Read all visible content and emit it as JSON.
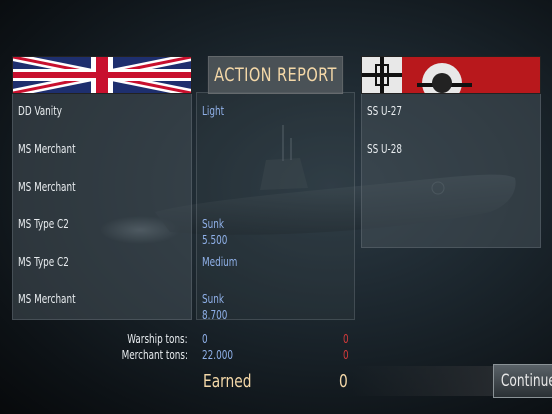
{
  "title": "ACTION REPORT",
  "ally_ships": [
    "DD Vanity",
    "MS Merchant",
    "MS Merchant",
    "MS Type C2",
    "MS Type C2",
    "MS Merchant"
  ],
  "outcomes": [
    {
      "line1": "Light",
      "line2": ""
    },
    {
      "line1": "",
      "line2": ""
    },
    {
      "line1": "",
      "line2": ""
    },
    {
      "line1": "Sunk",
      "line2": "5.500"
    },
    {
      "line1": "Medium",
      "line2": ""
    },
    {
      "line1": "Sunk",
      "line2": "8.700"
    }
  ],
  "enemy_ships": [
    "SS U-27",
    "SS U-28"
  ],
  "totals": {
    "warship_label": "Warship tons:",
    "merchant_label": "Merchant tons:",
    "warship_ally": "0",
    "merchant_ally": "22.000",
    "warship_enemy": "0",
    "merchant_enemy": "0"
  },
  "earned": {
    "label": "Earned",
    "value": "0"
  },
  "continue_label": "Continue",
  "colors": {
    "title": "#f4d8a8",
    "outcome": "#8fb0e8",
    "enemy_tons": "#d23a3a"
  }
}
